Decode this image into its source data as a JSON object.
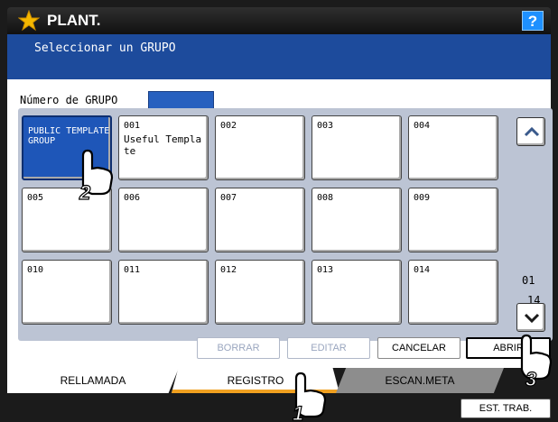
{
  "header": {
    "title": "PLANT.",
    "help_label": "?"
  },
  "instruction": "Seleccionar un GRUPO",
  "group_number": {
    "label": "Número de GRUPO",
    "value": ""
  },
  "tiles": [
    {
      "num": "",
      "name": "PUBLIC TEMPLATE GROUP",
      "selected": true
    },
    {
      "num": "001",
      "name": "Useful Template"
    },
    {
      "num": "002",
      "name": ""
    },
    {
      "num": "003",
      "name": ""
    },
    {
      "num": "004",
      "name": ""
    },
    {
      "num": "005",
      "name": ""
    },
    {
      "num": "006",
      "name": ""
    },
    {
      "num": "007",
      "name": ""
    },
    {
      "num": "008",
      "name": ""
    },
    {
      "num": "009",
      "name": ""
    },
    {
      "num": "010",
      "name": ""
    },
    {
      "num": "011",
      "name": ""
    },
    {
      "num": "012",
      "name": ""
    },
    {
      "num": "013",
      "name": ""
    },
    {
      "num": "014",
      "name": ""
    }
  ],
  "pager": {
    "current": "01",
    "total": "14"
  },
  "actions": {
    "delete_label": "BORRAR",
    "edit_label": "EDITAR",
    "cancel_label": "CANCELAR",
    "open_label": "ABRIR"
  },
  "tabs": {
    "recall": "RELLAMADA",
    "registry": "REGISTRO",
    "scan_meta": "ESCAN.META"
  },
  "status_label": "EST. TRAB.",
  "callouts": [
    "1",
    "2",
    "3"
  ],
  "colors": {
    "accent_blue": "#1e56b8",
    "tab_underline": "#f0a020",
    "help_blue": "#1e90ff"
  }
}
